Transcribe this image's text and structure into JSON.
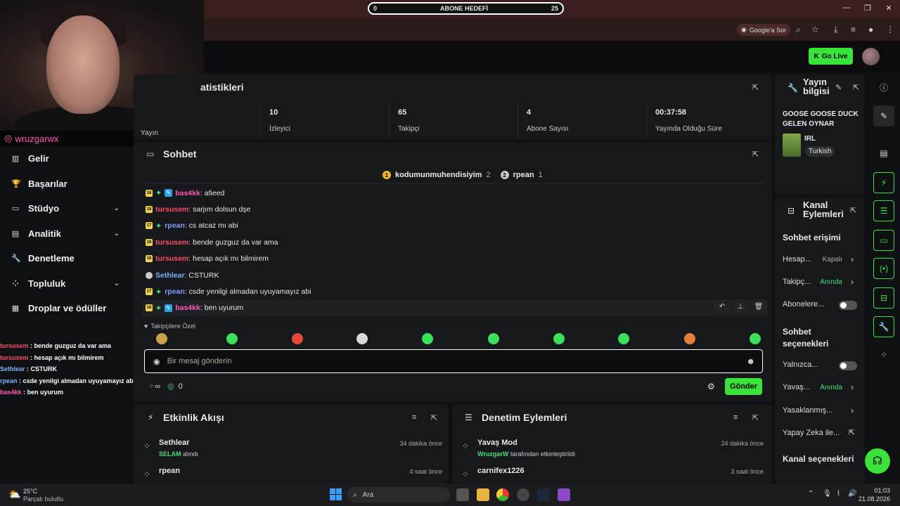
{
  "browser": {
    "goal_bar": {
      "left": "0",
      "title": "ABONE HEDEFİ",
      "right": "25"
    },
    "google_sor": "Google'a Sor"
  },
  "header": {
    "go_live": "Go Live"
  },
  "overlay": {
    "instagram": "wruzgarwx",
    "chat": [
      {
        "user": "tursusem",
        "text": " : bende guzguz da var ama",
        "color": "#ff4d6d"
      },
      {
        "user": "tursusem",
        "text": " : hesap açık mı bilmirem",
        "color": "#ff4d6d"
      },
      {
        "user": "Sethlear",
        "text": " : CSTURK",
        "color": "#7fb2ff"
      },
      {
        "user": "rpean",
        "text": " : csde yenilgi almadan uyuyamayız abi",
        "color": "#7fb2ff"
      },
      {
        "user": "bas4kk",
        "text": " : ben uyurum",
        "color": "#ff5ab8"
      }
    ]
  },
  "nav": {
    "items": [
      {
        "label": "Gelir",
        "icon": "bank-icon",
        "chevron": false
      },
      {
        "label": "Başarılar",
        "icon": "trophy-icon",
        "chevron": false
      },
      {
        "label": "Stüdyo",
        "icon": "studio-icon",
        "chevron": true
      },
      {
        "label": "Analitik",
        "icon": "analytics-icon",
        "chevron": true
      },
      {
        "label": "Denetleme",
        "icon": "wrench-icon",
        "chevron": false
      },
      {
        "label": "Topluluk",
        "icon": "community-icon",
        "chevron": true
      },
      {
        "label": "Droplar ve ödüller",
        "icon": "drops-icon",
        "chevron": false
      }
    ]
  },
  "stats": {
    "title": "atistikleri",
    "first_label": "Yayın",
    "items": [
      {
        "value": "10",
        "label": "İzleyici"
      },
      {
        "value": "65",
        "label": "Takipçi"
      },
      {
        "value": "4",
        "label": "Abone Sayısı"
      },
      {
        "value": "00:37:58",
        "label": "Yayında Olduğu Süre"
      }
    ]
  },
  "chat": {
    "title": "Sohbet",
    "leaders": [
      {
        "rank": "1",
        "name": "kodumunmuhendisiyim",
        "count": "2"
      },
      {
        "rank": "2",
        "name": "rpean",
        "count": "1"
      }
    ],
    "messages": [
      {
        "badge": "18",
        "sub": true,
        "pen": true,
        "user": "bas4kk",
        "color": "#ff5ab8",
        "text": ": afieed"
      },
      {
        "badge": "18",
        "sub": false,
        "pen": false,
        "user": "tursusem",
        "color": "#ff4d6d",
        "text": ": sarjım dolsun dşe"
      },
      {
        "badge": "17",
        "sub": true,
        "pen": false,
        "user": "rpean",
        "color": "#7f9cff",
        "text": ": cs atcaz mı abi"
      },
      {
        "badge": "18",
        "sub": false,
        "pen": false,
        "user": "tursusem",
        "color": "#ff4d6d",
        "text": ": bende guzguz da var ama"
      },
      {
        "badge": "18",
        "sub": false,
        "pen": false,
        "user": "tursusem",
        "color": "#ff4d6d",
        "text": ": hesap açık mı bilmirem"
      },
      {
        "badge": "",
        "sub": false,
        "pen": false,
        "user": "Sethlear",
        "color": "#7fb2ff",
        "text": ": CSTURK"
      },
      {
        "badge": "17",
        "sub": true,
        "pen": false,
        "user": "rpean",
        "color": "#7f9cff",
        "text": ": csde yenilgi almadan uyuyamayız abi"
      },
      {
        "badge": "18",
        "sub": true,
        "pen": true,
        "user": "bas4kk",
        "color": "#ff5ab8",
        "text": ": ben uyurum"
      }
    ],
    "emote_section": "Takipçilere Özel",
    "input_placeholder": "Bir mesaj gönderin",
    "footer_count": "0",
    "send": "Gönder"
  },
  "activity": {
    "title": "Etkinlik Akışı",
    "items": [
      {
        "name": "Sethlear",
        "sub_highlight": "SELAM",
        "sub_rest": " alındı",
        "time": "34 dakika önce"
      },
      {
        "name": "rpean",
        "sub_highlight": "",
        "sub_rest": "",
        "time": "4 saat önce"
      }
    ]
  },
  "modlog": {
    "title": "Denetim Eylemleri",
    "items": [
      {
        "name": "Yavaş Mod",
        "sub_highlight": "WruzgarW",
        "sub_rest": " tarafından etkinleştirildi",
        "time": "24 dakika önce"
      },
      {
        "name": "carnifex1226",
        "sub_highlight": "",
        "sub_rest": "",
        "time": "3 saat önce"
      }
    ]
  },
  "stream_info": {
    "title": "Yayın bilgisi",
    "stream_title": "GOOSE GOOSE DUCK GELEN OYNAR",
    "category": "IRL",
    "tag": "Turkish"
  },
  "channel_actions": {
    "title": "Kanal Eylemleri",
    "chat_access": "Sohbet erişimi",
    "rows1": [
      {
        "label": "Hesap...",
        "value": "Kapalı",
        "value_color": "#aaa",
        "type": "chevron"
      },
      {
        "label": "Takipç...",
        "value": "Anında",
        "value_color": "#46e07a",
        "type": "chevron"
      },
      {
        "label": "Abonelere...",
        "value": "",
        "value_color": "",
        "type": "toggle"
      }
    ],
    "chat_options": "Sohbet seçenekleri",
    "rows2": [
      {
        "label": "Yalnızca...",
        "value": "",
        "value_color": "",
        "type": "toggle"
      },
      {
        "label": "Yavaş...",
        "value": "Anında",
        "value_color": "#46e07a",
        "type": "chevron"
      },
      {
        "label": "Yasaklanmış...",
        "value": "",
        "value_color": "",
        "type": "chevron"
      },
      {
        "label": "Yapay Zeka ile...",
        "value": "",
        "value_color": "",
        "type": "external"
      }
    ],
    "channel_options": "Kanal seçenekleri"
  },
  "taskbar": {
    "weather_temp": "25°C",
    "weather_desc": "Parçalı bulutlu",
    "search": "Ara",
    "time": "01:03",
    "date": "21.08.2026"
  },
  "colors": {
    "accent": "#3ae33a",
    "panel": "#17181b",
    "background": "#0f1012"
  }
}
